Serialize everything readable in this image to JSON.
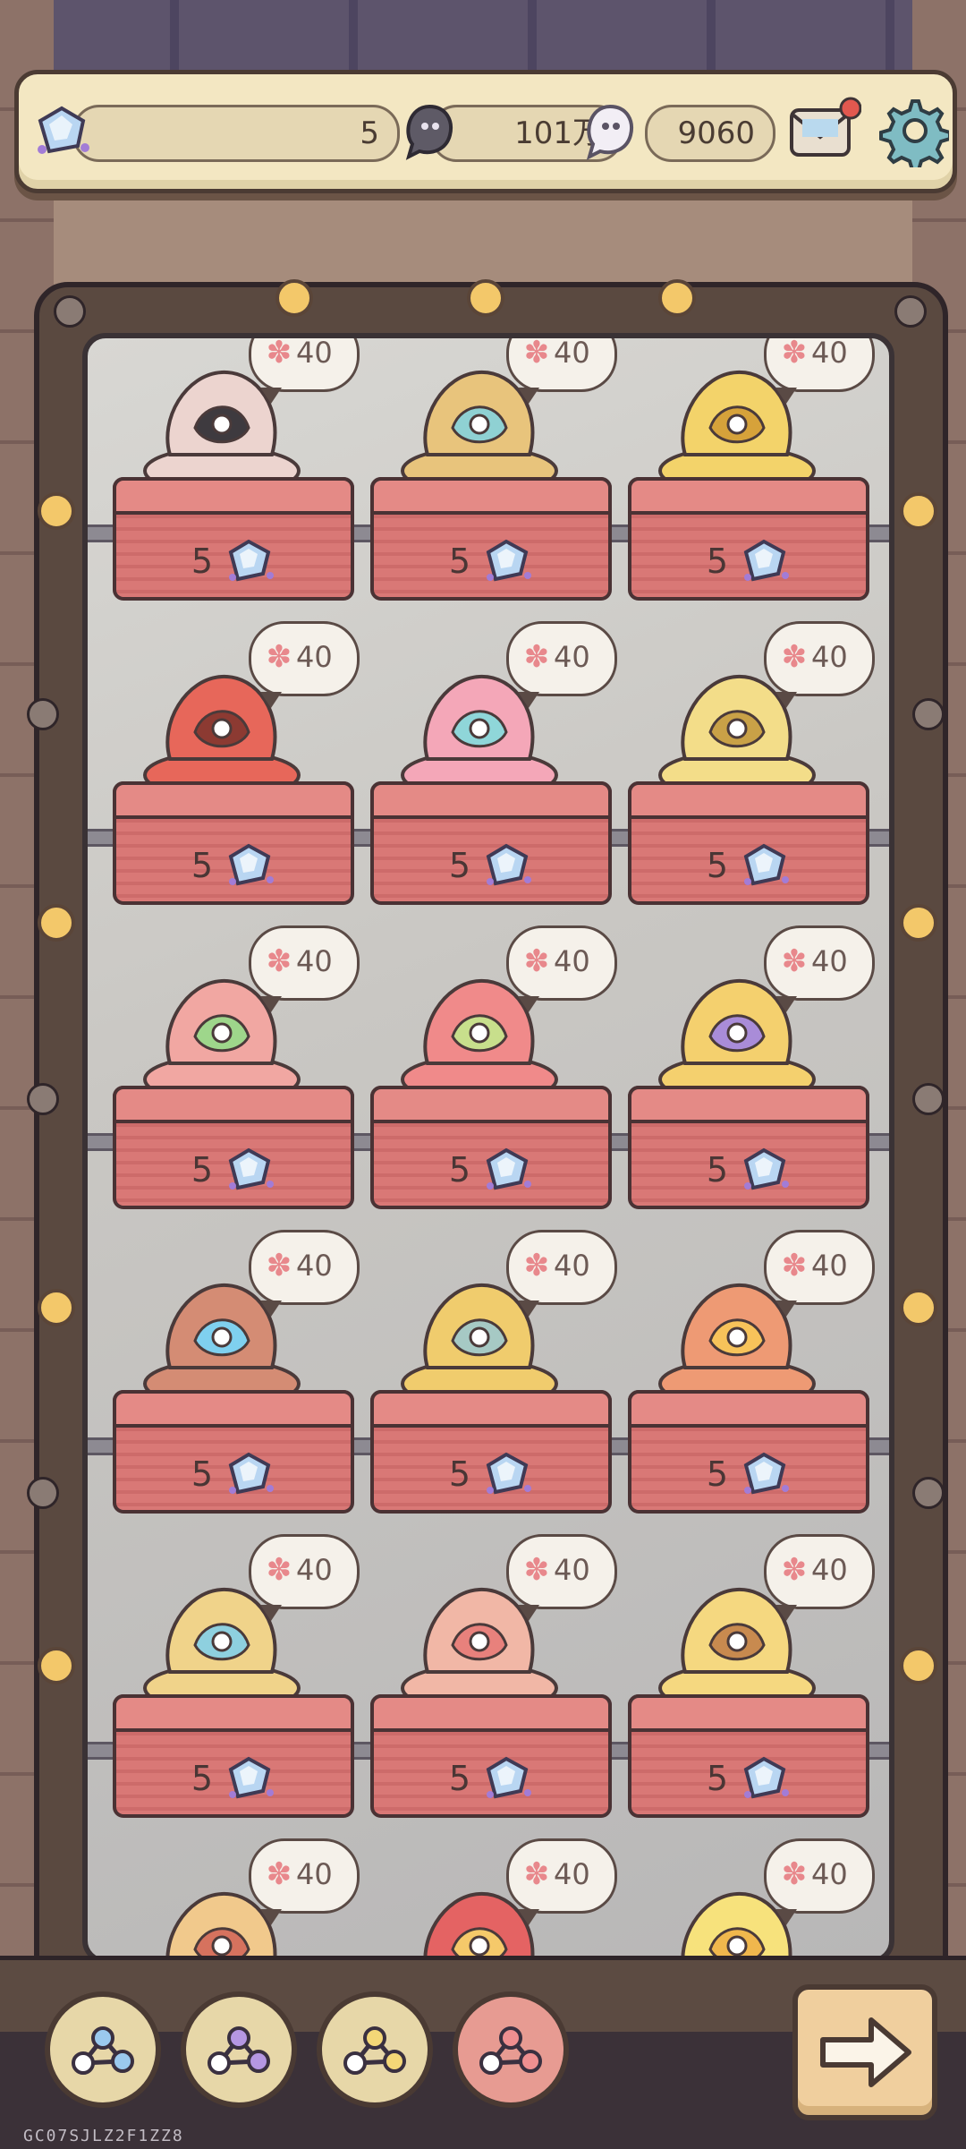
{
  "topbar": {
    "gems": "5",
    "dark_currency": "101万",
    "light_currency": "9060"
  },
  "shop": {
    "items": [
      {
        "name": "mushroom-antler",
        "price": "5",
        "badge": "40",
        "colors": [
          "#ecd4cf",
          "#3e3a3f"
        ]
      },
      {
        "name": "heart-flower-ring",
        "price": "5",
        "badge": "40",
        "colors": [
          "#e8c47c",
          "#8fd1d3"
        ]
      },
      {
        "name": "golden-beast",
        "price": "5",
        "badge": "40",
        "colors": [
          "#f3d36a",
          "#d6a23a"
        ]
      },
      {
        "name": "spotted-red-creature",
        "price": "5",
        "badge": "40",
        "colors": [
          "#e7675a",
          "#8c3a32"
        ]
      },
      {
        "name": "rainbow-brain",
        "price": "5",
        "badge": "40",
        "colors": [
          "#f4a7b8",
          "#8fd6d9"
        ]
      },
      {
        "name": "golden-arm-ring",
        "price": "5",
        "badge": "40",
        "colors": [
          "#f3dd89",
          "#c9a147"
        ]
      },
      {
        "name": "rainbow-shell",
        "price": "5",
        "badge": "40",
        "colors": [
          "#f1a7a2",
          "#9ed68b"
        ]
      },
      {
        "name": "tongue-mouth",
        "price": "5",
        "badge": "40",
        "colors": [
          "#f08a8a",
          "#c8df8c"
        ]
      },
      {
        "name": "golden-eye-orb",
        "price": "5",
        "badge": "40",
        "colors": [
          "#f4d06e",
          "#a98cd8"
        ]
      },
      {
        "name": "blue-flame-claw",
        "price": "5",
        "badge": "40",
        "colors": [
          "#d48c74",
          "#7fd0ef"
        ]
      },
      {
        "name": "crown-tentacle",
        "price": "5",
        "badge": "40",
        "colors": [
          "#f0cc6d",
          "#a6c9c4"
        ]
      },
      {
        "name": "orange-eyeball",
        "price": "5",
        "badge": "40",
        "colors": [
          "#ee9a74",
          "#f7c35a"
        ]
      },
      {
        "name": "golden-mask",
        "price": "5",
        "badge": "40",
        "colors": [
          "#f0d38a",
          "#8ed0df"
        ]
      },
      {
        "name": "feather-shell",
        "price": "5",
        "badge": "40",
        "colors": [
          "#f1b7a6",
          "#e8817c"
        ]
      },
      {
        "name": "flaming-scroll",
        "price": "5",
        "badge": "40",
        "colors": [
          "#f5d880",
          "#c88a4f"
        ]
      },
      {
        "name": "ornate-helm",
        "price": "5",
        "badge": "40",
        "colors": [
          "#f1c98c",
          "#d6725e"
        ]
      },
      {
        "name": "eyeball-stalk",
        "price": "5",
        "badge": "40",
        "colors": [
          "#e46363",
          "#f5c96a"
        ]
      },
      {
        "name": "golden-flame-bush",
        "price": "5",
        "badge": "40",
        "colors": [
          "#f7e27c",
          "#f0b74d"
        ]
      }
    ]
  },
  "filters": [
    "blue-filter",
    "purple-filter",
    "yellow-filter",
    "red-filter"
  ],
  "footer": {
    "code": "GC07SJLZ2F1ZZ8"
  },
  "colors": {
    "accent": "#f3e7c2",
    "pedestal": "#d97876",
    "frame": "#5a4940"
  }
}
